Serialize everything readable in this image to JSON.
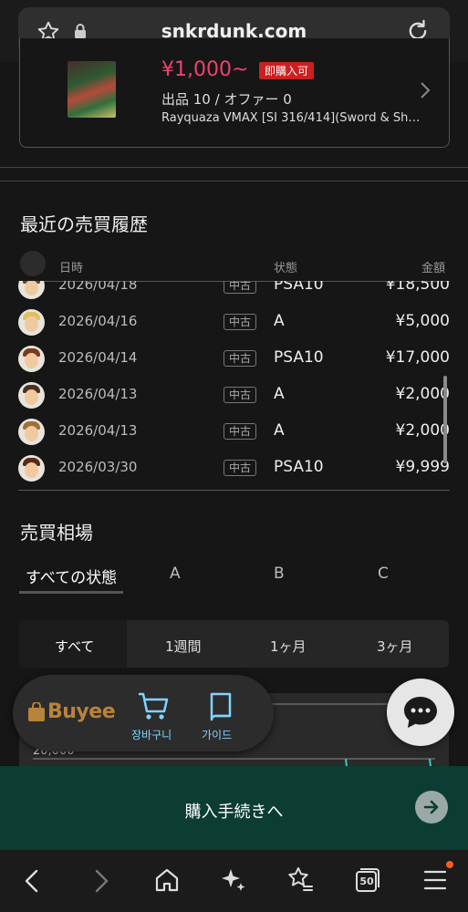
{
  "browser": {
    "url": "snkrdunk.com",
    "tab_count": "50"
  },
  "product": {
    "price": "¥1,000~",
    "badge": "即購入可",
    "listing": "出品 10 / オファー 0",
    "name": "Rayquaza VMAX [SI 316/414](Sword & Shie…"
  },
  "history": {
    "title": "最近の売買履歴",
    "headers": {
      "date": "日時",
      "condition": "状態",
      "price": "金額"
    },
    "rows": [
      {
        "date": "2026/04/18",
        "used": "中古",
        "condition": "PSA10",
        "price": "¥18,500"
      },
      {
        "date": "2026/04/16",
        "used": "中古",
        "condition": "A",
        "price": "¥5,000"
      },
      {
        "date": "2026/04/14",
        "used": "中古",
        "condition": "PSA10",
        "price": "¥17,000"
      },
      {
        "date": "2026/04/13",
        "used": "中古",
        "condition": "A",
        "price": "¥2,000"
      },
      {
        "date": "2026/04/13",
        "used": "中古",
        "condition": "A",
        "price": "¥2,000"
      },
      {
        "date": "2026/03/30",
        "used": "中古",
        "condition": "PSA10",
        "price": "¥9,999"
      }
    ]
  },
  "market": {
    "title": "売買相場",
    "filter_tabs": [
      "すべての状態",
      "A",
      "B",
      "C"
    ],
    "period_tabs": [
      "すべて",
      "1週間",
      "1ヶ月",
      "3ヶ月"
    ],
    "chart_y_label": "20,000"
  },
  "buyee": {
    "logo": "Buyee",
    "cart": "장바구니",
    "guide": "가이드"
  },
  "purchase": {
    "label": "購入手続きへ"
  },
  "colors": {
    "price": "#f0426b",
    "badge": "#cc1f1f",
    "buy_bar": "#0b3d33",
    "accent_link": "#7fd4ff"
  }
}
